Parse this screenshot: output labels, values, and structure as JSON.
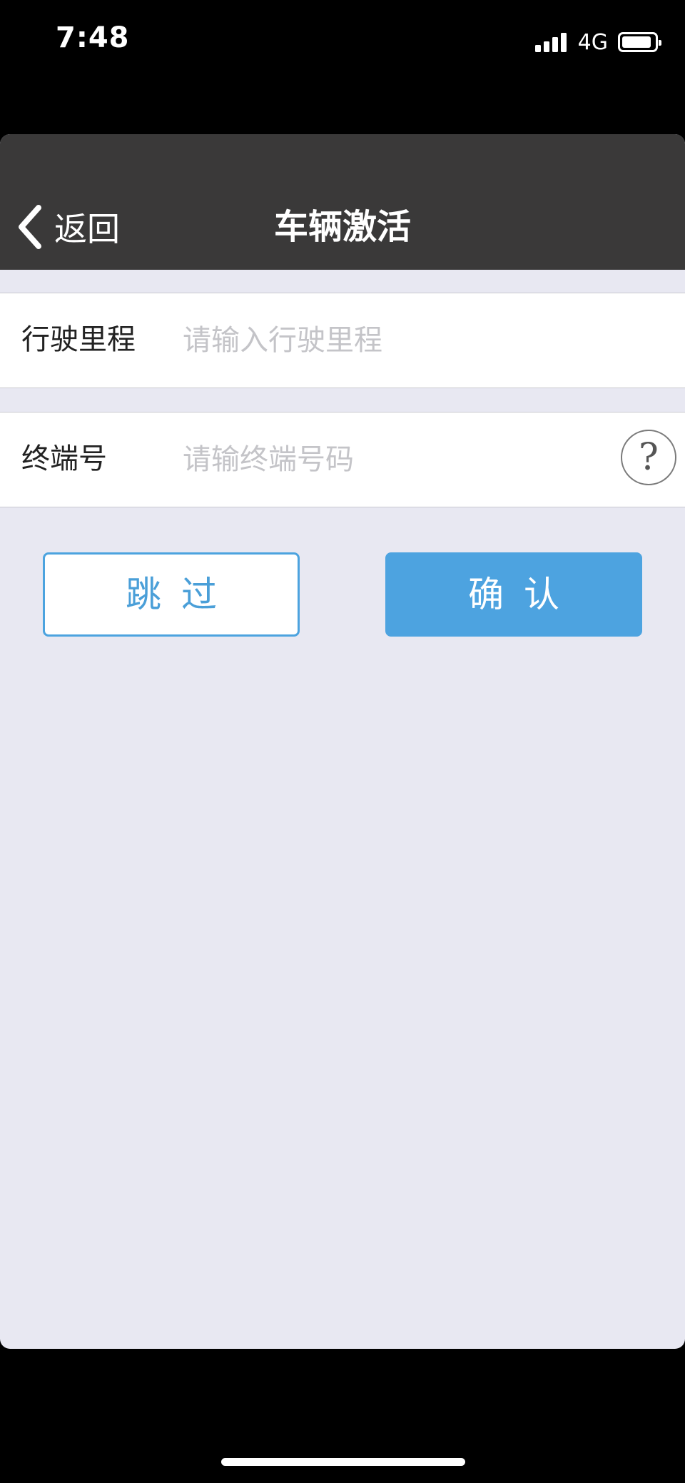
{
  "status_bar": {
    "time": "7:48",
    "network": "4G",
    "signal_bars": 4,
    "battery_level": 0.9,
    "icons": [
      "signal-icon",
      "battery-icon"
    ]
  },
  "nav": {
    "back_label": "返回",
    "back_icon": "chevron-left-icon",
    "title": "车辆激活"
  },
  "form": {
    "mileage": {
      "label": "行驶里程",
      "placeholder": "请输入行驶里程",
      "value": ""
    },
    "terminal": {
      "label": "终端号",
      "placeholder": "请输终端号码",
      "value": "",
      "help_icon": "question-circle-icon",
      "help_glyph": "?"
    }
  },
  "actions": {
    "skip_label": "跳过",
    "confirm_label": "确认"
  },
  "colors": {
    "nav_background": "#3a3939",
    "page_background": "#e8e8f2",
    "accent": "#4da3e0",
    "placeholder": "#c4c4c8"
  }
}
